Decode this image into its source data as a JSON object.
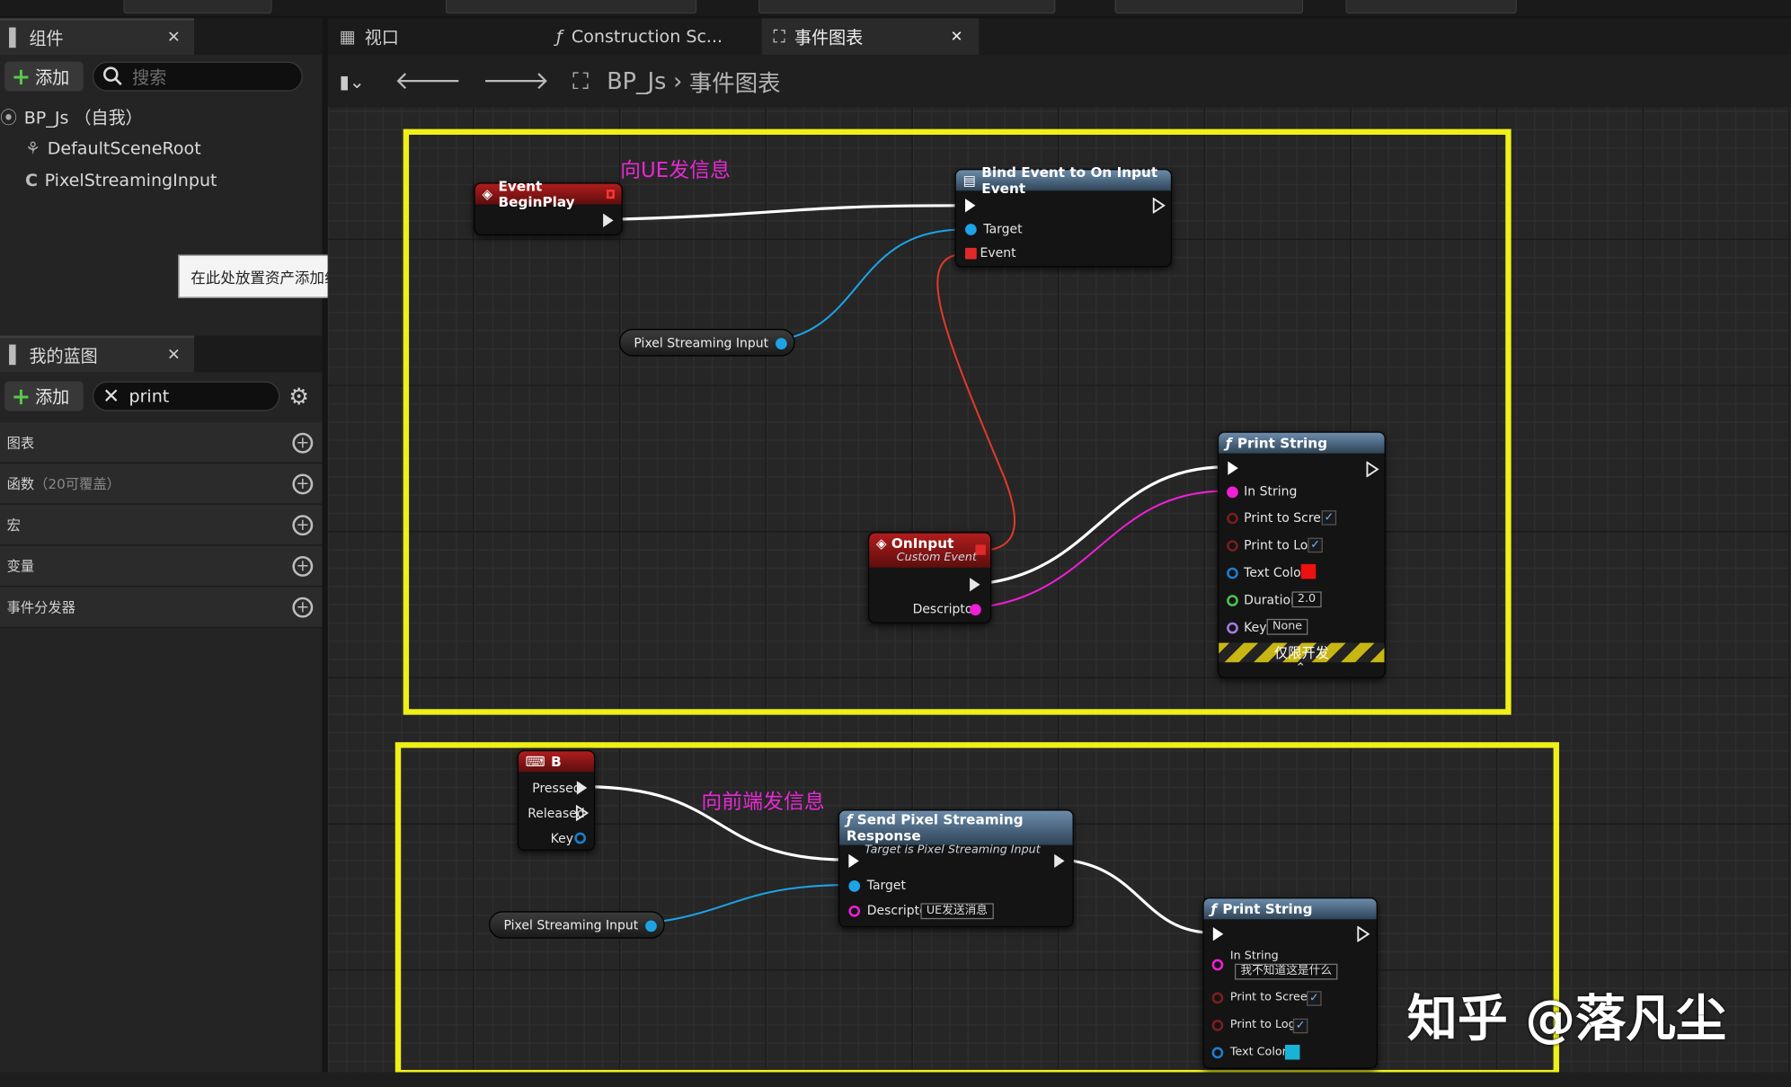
{
  "components_panel": {
    "tab": "组件",
    "add_label": "添加",
    "search_placeholder": "搜索",
    "tree": [
      {
        "label": "BP_Js （自我）"
      },
      {
        "label": "DefaultSceneRoot"
      },
      {
        "label": "PixelStreamingInput"
      }
    ],
    "hint": "在此处放置资产添加组件。"
  },
  "blueprint_panel": {
    "tab": "我的蓝图",
    "add_label": "添加",
    "search_value": "print",
    "categories": [
      {
        "label": "图表",
        "sub": ""
      },
      {
        "label": "函数",
        "sub": "（20可覆盖）"
      },
      {
        "label": "宏",
        "sub": ""
      },
      {
        "label": "变量",
        "sub": ""
      },
      {
        "label": "事件分发器",
        "sub": ""
      }
    ]
  },
  "editor_tabs": [
    {
      "label": "视口",
      "icon": "viewport-icon"
    },
    {
      "label": "Construction Sc...",
      "icon": "function-icon"
    },
    {
      "label": "事件图表",
      "icon": "graph-icon",
      "active": true
    }
  ],
  "breadcrumb": {
    "blueprint": "BP_Js",
    "graph": "事件图表"
  },
  "group1": {
    "annotation": "向UE发信息",
    "begin_play": {
      "title": "Event BeginPlay"
    },
    "bind_event": {
      "title": "Bind Event to On Input Event",
      "pins": [
        "Target",
        "Event"
      ]
    },
    "var1": "Pixel Streaming Input",
    "on_input": {
      "title": "OnInput",
      "subtitle": "Custom Event",
      "pin": "Descriptor"
    },
    "print1": {
      "title": "Print String",
      "pins": [
        "In String",
        "Print to Screen",
        "Print to Log",
        "Text Color",
        "Duration",
        "Key"
      ],
      "duration": "2.0",
      "key": "None",
      "dev_only": "仅限开发",
      "text_color": "#ee1111"
    }
  },
  "group2": {
    "annotation": "向前端发信息",
    "key_b": {
      "title": "B",
      "pins": [
        "Pressed",
        "Released",
        "Key"
      ]
    },
    "var2": "Pixel Streaming Input",
    "send": {
      "title": "Send Pixel Streaming Response",
      "subtitle": "Target is Pixel Streaming Input",
      "pins": [
        "Target",
        "Descriptor"
      ],
      "descriptor": "UE发送消息"
    },
    "print2": {
      "title": "Print String",
      "pins": [
        "In String",
        "Print to Screen",
        "Print to Log",
        "Text Color"
      ],
      "in_string": "我不知道这是什么",
      "text_color": "#19b3d6"
    }
  },
  "watermark": "知乎 @落凡尘",
  "colors": {
    "frame": "#f0f018",
    "annotation": "#e62ad2",
    "exec_wire": "#ffffff",
    "object_wire": "#1da3e6",
    "string_wire": "#ef20d5",
    "delegate_wire": "#e03a2a"
  }
}
